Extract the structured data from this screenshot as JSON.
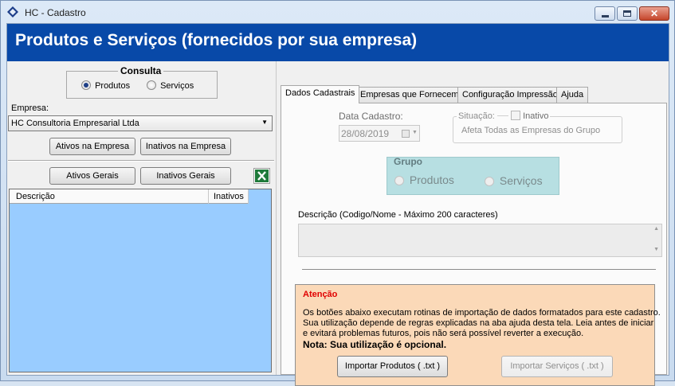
{
  "window": {
    "title": "HC - Cadastro"
  },
  "banner": {
    "heading": "Produtos e Serviços (fornecidos por sua empresa)"
  },
  "consulta": {
    "legend": "Consulta",
    "options": {
      "produtos": "Produtos",
      "servicos": "Serviços"
    },
    "selected": "Produtos"
  },
  "empresa": {
    "label": "Empresa:",
    "selected": "HC Consultoria Empresarial Ltda",
    "btn_ativos": "Ativos na Empresa",
    "btn_inativos": "Inativos na Empresa"
  },
  "gerais": {
    "btn_ativos": "Ativos Gerais",
    "btn_inativos": "Inativos Gerais",
    "excel_icon": "excel-icon"
  },
  "list": {
    "columns": [
      "Descrição",
      "Inativos"
    ],
    "rows": []
  },
  "tabs": [
    "Dados Cadastrais",
    "Empresas que Fornecem",
    "Configuração Impressão",
    "Ajuda"
  ],
  "form": {
    "data_cadastro_label": "Data Cadastro:",
    "data_cadastro_value": "28/08/2019",
    "situacao_legend": "Situação:",
    "inativo_label": "Inativo",
    "situacao_note": "Afeta Todas as Empresas do Grupo",
    "grupo_legend": "Grupo",
    "grupo_produtos": "Produtos",
    "grupo_servicos": "Serviços",
    "descricao_label": "Descrição (Codigo/Nome - Máximo 200 caracteres)",
    "descricao_value": ""
  },
  "atencao": {
    "title": "Atenção",
    "line1": "Os botões abaixo executam rotinas de importação de dados formatados para este cadastro.",
    "line2": "Sua utilização depende de regras explicadas na aba ajuda desta tela. Leia antes de iniciar",
    "line3": "e evitará problemas futuros, pois não será possível reverter a execução.",
    "nota": "Nota: Sua utilização é opcional.",
    "btn_produtos": "Importar Produtos ( .txt )",
    "btn_servicos": "Importar Serviços ( .txt )"
  },
  "colors": {
    "banner": "#0849a8",
    "list_bg": "#99ccff",
    "grupo_bg": "#b7dfe2",
    "atencao_bg": "#fbd9b8",
    "atencao_title": "#e00000"
  }
}
